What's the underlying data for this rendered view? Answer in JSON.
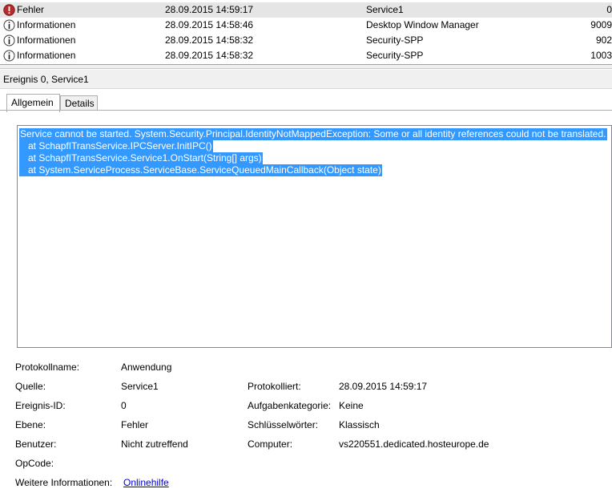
{
  "events": [
    {
      "level": "Fehler",
      "date": "28.09.2015 14:59:17",
      "source": "Service1",
      "id": "0",
      "icon": "error-icon",
      "selected": true
    },
    {
      "level": "Informationen",
      "date": "28.09.2015 14:58:46",
      "source": "Desktop Window Manager",
      "id": "9009",
      "icon": "info-icon",
      "selected": false
    },
    {
      "level": "Informationen",
      "date": "28.09.2015 14:58:32",
      "source": "Security-SPP",
      "id": "902",
      "icon": "info-icon",
      "selected": false
    },
    {
      "level": "Informationen",
      "date": "28.09.2015 14:58:32",
      "source": "Security-SPP",
      "id": "1003",
      "icon": "info-icon",
      "selected": false
    }
  ],
  "detail": {
    "title": "Ereignis 0, Service1",
    "tabs": [
      "Allgemein",
      "Details"
    ],
    "message_lines": [
      "Service cannot be started. System.Security.Principal.IdentityNotMappedException: Some or all identity references could not be translated.",
      "   at SchapfITransService.IPCServer.InitIPC()",
      "   at SchapfITransService.Service1.OnStart(String[] args)",
      "   at System.ServiceProcess.ServiceBase.ServiceQueuedMainCallback(Object state)"
    ],
    "props": {
      "protokollname_label": "Protokollname:",
      "protokollname": "Anwendung",
      "quelle_label": "Quelle:",
      "quelle": "Service1",
      "protokolliert_label": "Protokolliert:",
      "protokolliert": "28.09.2015 14:59:17",
      "ereignis_id_label": "Ereignis-ID:",
      "ereignis_id": "0",
      "aufgabenkategorie_label": "Aufgabenkategorie:",
      "aufgabenkategorie": "Keine",
      "ebene_label": "Ebene:",
      "ebene": "Fehler",
      "schluesselwoerter_label": "Schlüsselwörter:",
      "schluesselwoerter": "Klassisch",
      "benutzer_label": "Benutzer:",
      "benutzer": "Nicht zutreffend",
      "computer_label": "Computer:",
      "computer": "vs220551.dedicated.hosteurope.de",
      "opcode_label": "OpCode:",
      "opcode": "",
      "weitere_label": "Weitere Informationen:",
      "weitere_link": "Onlinehilfe"
    }
  },
  "colors": {
    "error": "#c42b1c",
    "selection": "#3399ff",
    "link": "#0000cc"
  }
}
